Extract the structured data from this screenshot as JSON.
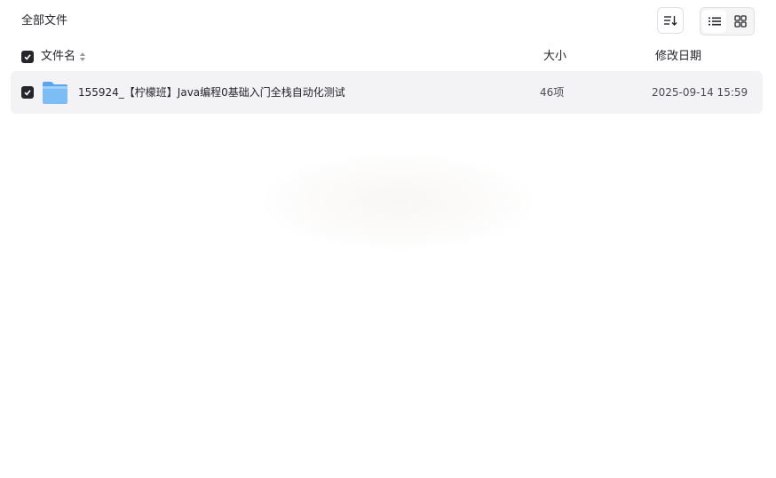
{
  "header": {
    "breadcrumb": "全部文件",
    "sort_icon": "sort-icon",
    "view_list_icon": "list-view-icon",
    "view_grid_icon": "grid-view-icon",
    "active_view": "list"
  },
  "table": {
    "columns": {
      "name": "文件名",
      "size": "大小",
      "date": "修改日期"
    },
    "select_all_checked": true,
    "rows": [
      {
        "icon": "folder-icon",
        "checked": true,
        "name": "155924_【柠檬班】Java编程0基础入门全栈自动化测试",
        "size": "46项",
        "modified": "2025-09-14 15:59"
      }
    ]
  },
  "colors": {
    "text": "#25262b",
    "row_bg": "#f3f3f5",
    "folder": "#6fb3f2",
    "border": "#dfe0e4"
  }
}
